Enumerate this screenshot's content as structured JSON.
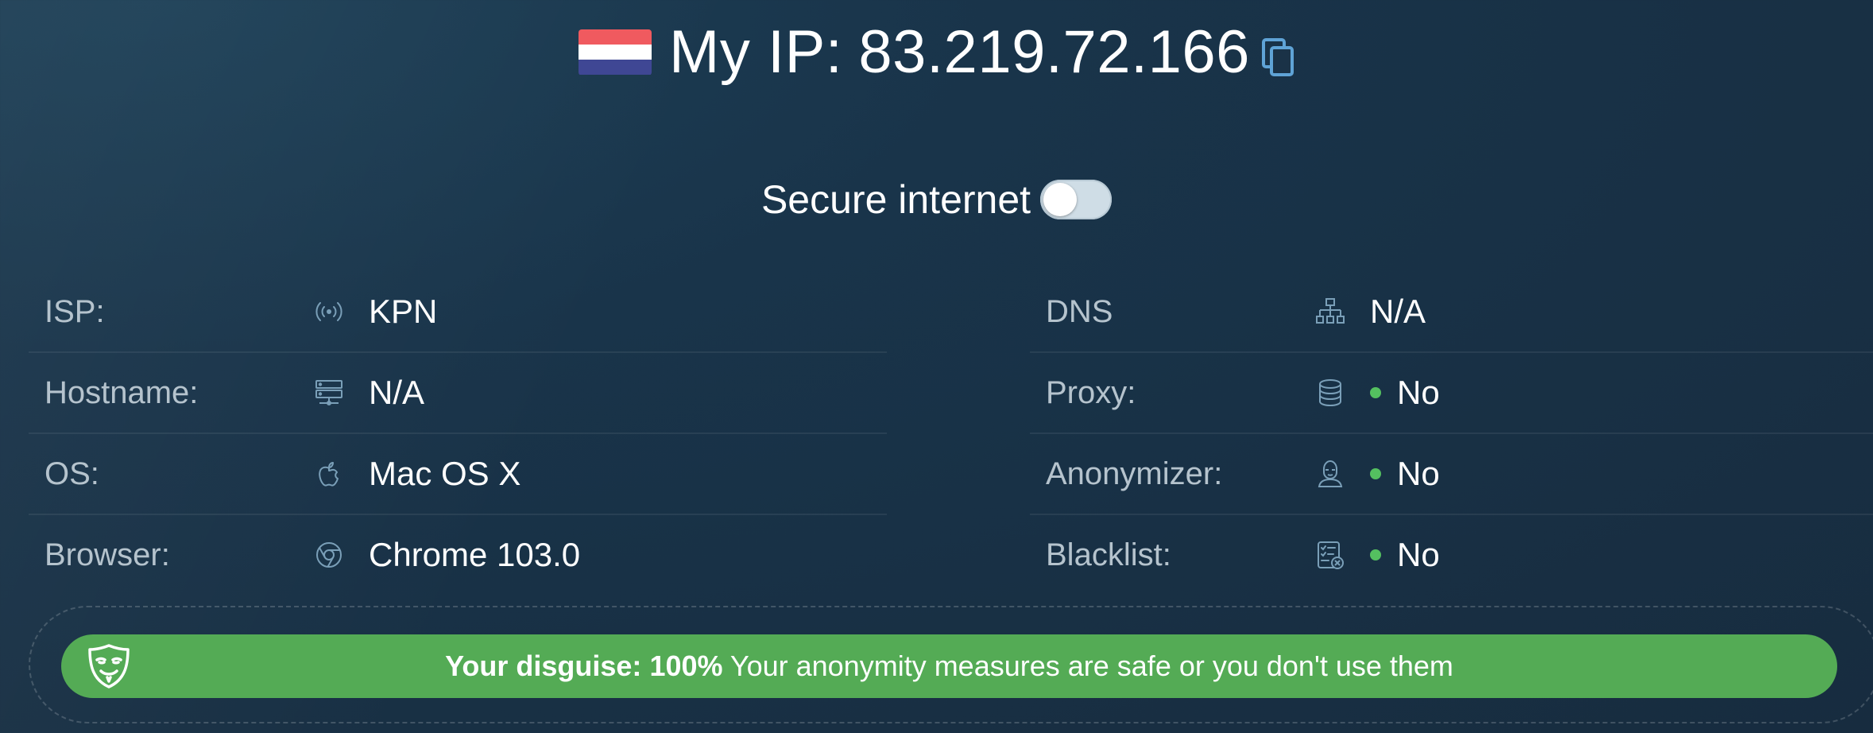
{
  "header": {
    "title_prefix": "My IP:",
    "ip": "83.219.72.166",
    "flag_colors": [
      "#f05a5f",
      "#ffffff",
      "#3f4794"
    ]
  },
  "secure_internet": {
    "label": "Secure internet",
    "enabled": false
  },
  "left_info": [
    {
      "label": "ISP:",
      "icon": "broadcast-icon",
      "value": "KPN"
    },
    {
      "label": "Hostname:",
      "icon": "server-icon",
      "value": "N/A"
    },
    {
      "label": "OS:",
      "icon": "apple-icon",
      "value": "Mac OS X"
    },
    {
      "label": "Browser:",
      "icon": "chrome-icon",
      "value": "Chrome 103.0"
    }
  ],
  "right_info": [
    {
      "label": "DNS",
      "icon": "network-icon",
      "value": "N/A"
    },
    {
      "label": "Proxy:",
      "icon": "database-icon",
      "value": "No"
    },
    {
      "label": "Anonymizer:",
      "icon": "anonymous-user-icon",
      "value": "No"
    },
    {
      "label": "Blacklist:",
      "icon": "checklist-icon",
      "value": "No"
    }
  ],
  "disguise": {
    "title": "Your disguise:",
    "percent": "100%",
    "message": "Your anonymity measures are safe or you don't use them"
  },
  "colors": {
    "accent_blue": "#5fa3d6",
    "status_green": "#54c060",
    "disguise_bar": "#54ab55",
    "icon": "#7a9fb8"
  }
}
